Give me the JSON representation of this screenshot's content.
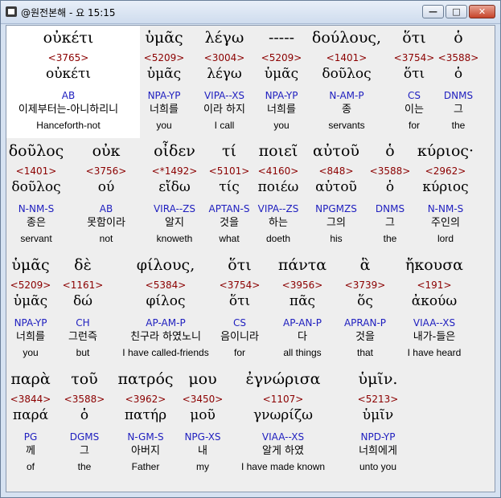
{
  "window": {
    "title": "@원전본해 - 요 15:15",
    "buttons": {
      "minimize": "—",
      "maximize": "□",
      "close": "✕"
    }
  },
  "rows": [
    {
      "words": [
        {
          "greek": "οὐκέτι",
          "strong": "<3765>",
          "lemma": "οὐκέτι",
          "parse": "AB",
          "kor": "이제부터는-아니하리니",
          "eng": "Hanceforth-not"
        },
        {
          "greek": "ὑμᾶς",
          "strong": "<5209>",
          "lemma": "ὑμᾶς",
          "parse": "NPA-YP",
          "kor": "너희를",
          "eng": "you"
        },
        {
          "greek": "λέγω",
          "strong": "<3004>",
          "lemma": "λέγω",
          "parse": "VIPA--XS",
          "kor": "이라 하지",
          "eng": "I call"
        },
        {
          "greek": "-----",
          "strong": "<5209>",
          "lemma": "ὑμᾶς",
          "parse": "NPA-YP",
          "kor": "너희를",
          "eng": "you"
        },
        {
          "greek": "δούλους,",
          "strong": "<1401>",
          "lemma": "δοῦλος",
          "parse": "N-AM-P",
          "kor": "종",
          "eng": "servants"
        },
        {
          "greek": "ὅτι",
          "strong": "<3754>",
          "lemma": "ὅτι",
          "parse": "CS",
          "kor": "이는",
          "eng": "for"
        },
        {
          "greek": "ὁ",
          "strong": "<3588>",
          "lemma": "ὁ",
          "parse": "DNMS",
          "kor": "그",
          "eng": "the"
        }
      ]
    },
    {
      "words": [
        {
          "greek": "δοῦλος",
          "strong": "<1401>",
          "lemma": "δοῦλος",
          "parse": "N-NM-S",
          "kor": "종은",
          "eng": "servant"
        },
        {
          "greek": "οὐκ",
          "strong": "<3756>",
          "lemma": "ού",
          "parse": "AB",
          "kor": "못함이라",
          "eng": "not"
        },
        {
          "greek": "οἶδεν",
          "strong": "<*1492>",
          "lemma": "εἴδω",
          "parse": "VIRA--ZS",
          "kor": "알지",
          "eng": "knoweth"
        },
        {
          "greek": "τί",
          "strong": "<5101>",
          "lemma": "τίς",
          "parse": "APTAN-S",
          "kor": "것을",
          "eng": "what"
        },
        {
          "greek": "ποιεῖ",
          "strong": "<4160>",
          "lemma": "ποιέω",
          "parse": "VIPA--ZS",
          "kor": "하는",
          "eng": "doeth"
        },
        {
          "greek": "αὐτοῦ",
          "strong": "<848>",
          "lemma": "αὑτοῦ",
          "parse": "NPGMZS",
          "kor": "그의",
          "eng": "his"
        },
        {
          "greek": "ὁ",
          "strong": "<3588>",
          "lemma": "ὁ",
          "parse": "DNMS",
          "kor": "그",
          "eng": "the"
        },
        {
          "greek": "κύριος·",
          "strong": "<2962>",
          "lemma": "κύριος",
          "parse": "N-NM-S",
          "kor": "주인의",
          "eng": "lord"
        }
      ]
    },
    {
      "words": [
        {
          "greek": "ὑμᾶς",
          "strong": "<5209>",
          "lemma": "ὑμᾶς",
          "parse": "NPA-YP",
          "kor": "너희를",
          "eng": "you"
        },
        {
          "greek": "δὲ",
          "strong": "<1161>",
          "lemma": "δώ",
          "parse": "CH",
          "kor": "그런즉",
          "eng": "but"
        },
        {
          "greek": "φίλους,",
          "strong": "<5384>",
          "lemma": "φίλος",
          "parse": "AP-AM-P",
          "kor": "친구라 하였노니",
          "eng": "I have called-friends"
        },
        {
          "greek": "ὅτι",
          "strong": "<3754>",
          "lemma": "ὅτι",
          "parse": "CS",
          "kor": "음이니라",
          "eng": "for"
        },
        {
          "greek": "πάντα",
          "strong": "<3956>",
          "lemma": "πᾶς",
          "parse": "AP-AN-P",
          "kor": "다",
          "eng": "all things"
        },
        {
          "greek": "ἃ",
          "strong": "<3739>",
          "lemma": "ὅς",
          "parse": "APRAN-P",
          "kor": "것을",
          "eng": "that"
        },
        {
          "greek": "ἤκουσα",
          "strong": "<191>",
          "lemma": "ἀκούω",
          "parse": "VIAA--XS",
          "kor": "내가-들은",
          "eng": "I have heard"
        }
      ]
    },
    {
      "words": [
        {
          "greek": "παρὰ",
          "strong": "<3844>",
          "lemma": "παρά",
          "parse": "PG",
          "kor": "께",
          "eng": "of"
        },
        {
          "greek": "τοῦ",
          "strong": "<3588>",
          "lemma": "ὁ",
          "parse": "DGMS",
          "kor": "그",
          "eng": "the"
        },
        {
          "greek": "πατρός",
          "strong": "<3962>",
          "lemma": "πατήρ",
          "parse": "N-GM-S",
          "kor": "아버지",
          "eng": "Father"
        },
        {
          "greek": "μου",
          "strong": "<3450>",
          "lemma": "μοῦ",
          "parse": "NPG-XS",
          "kor": "내",
          "eng": "my"
        },
        {
          "greek": "ἐγνώρισα",
          "strong": "<1107>",
          "lemma": "γνωρίζω",
          "parse": "VIAA--XS",
          "kor": "알게 하였",
          "eng": "I have made known"
        },
        {
          "greek": "ὑμῖν.",
          "strong": "<5213>",
          "lemma": "ὑμῖν",
          "parse": "NPD-YP",
          "kor": "너희에게",
          "eng": "unto you"
        }
      ]
    }
  ]
}
